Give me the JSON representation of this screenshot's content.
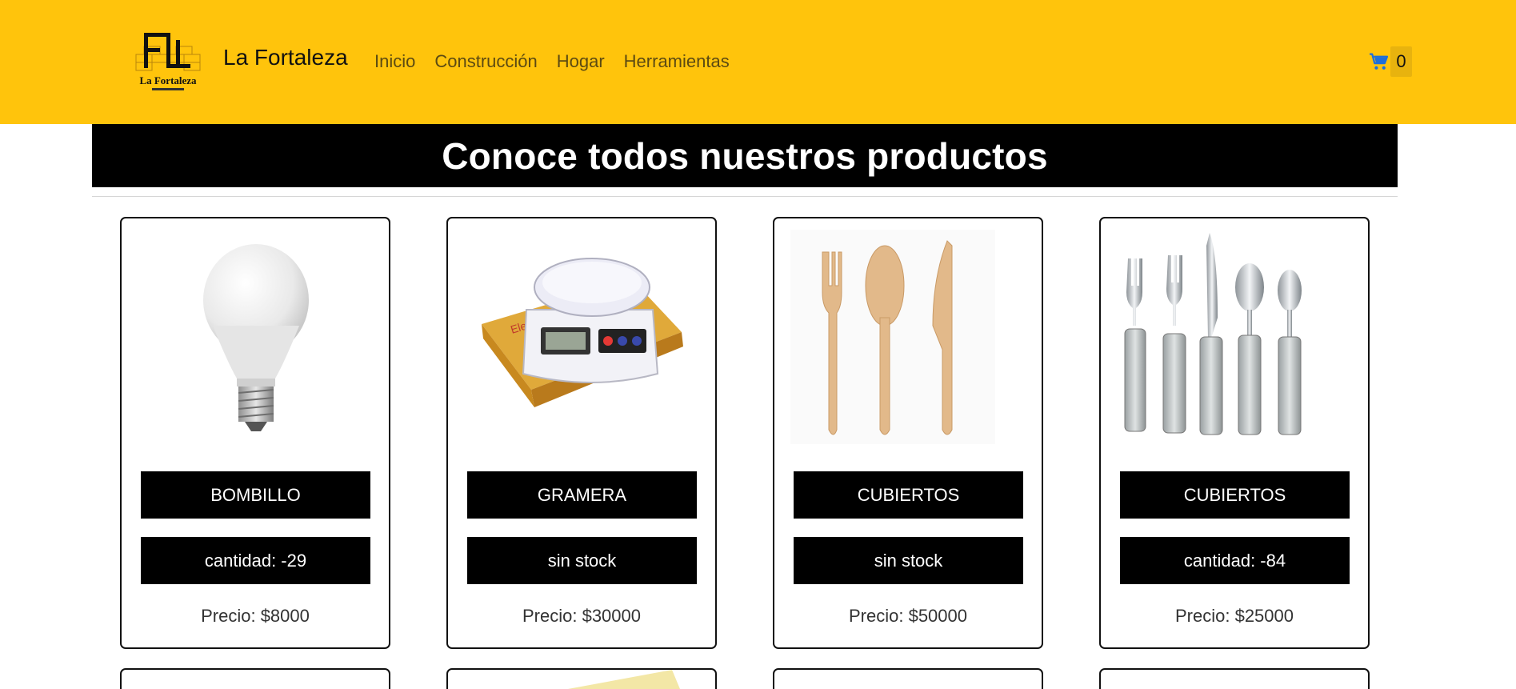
{
  "header": {
    "brand_name": "La Fortaleza",
    "logo_text": "La Fortaleza",
    "nav": [
      "Inicio",
      "Construcción",
      "Hogar",
      "Herramientas"
    ],
    "cart_icon": "cart-icon",
    "cart_count": "0"
  },
  "colors": {
    "navbar_bg": "#ffc40c",
    "banner_bg": "#000000",
    "cart_icon": "#1e6fd9"
  },
  "banner": {
    "title": "Conoce todos nuestros productos"
  },
  "products": [
    {
      "name": "BOMBILLO",
      "stock": "cantidad: -29",
      "price": "Precio: $8000"
    },
    {
      "name": "GRAMERA",
      "stock": "sin stock",
      "price": "Precio: $30000"
    },
    {
      "name": "CUBIERTOS",
      "stock": "sin stock",
      "price": "Precio: $50000"
    },
    {
      "name": "CUBIERTOS",
      "stock": "cantidad: -84",
      "price": "Precio: $25000"
    }
  ]
}
